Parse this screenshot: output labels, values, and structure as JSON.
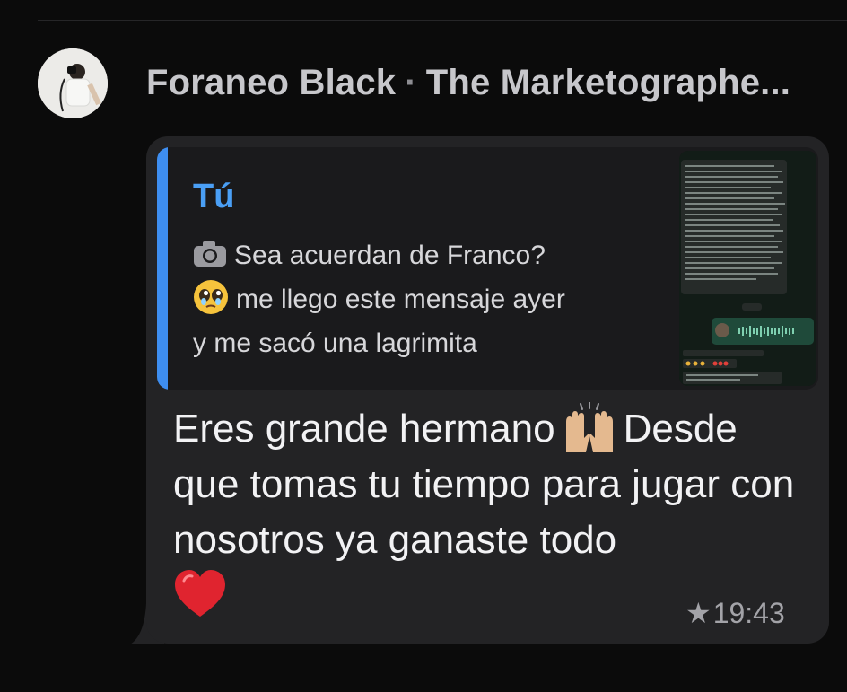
{
  "header": {
    "sender_name": "Foraneo Black",
    "separator": "·",
    "group_name": "The Marketographe..."
  },
  "message": {
    "reply": {
      "author": "Tú",
      "line1": "Sea acuerdan de Franco?",
      "line2": "me llego este mensaje ayer",
      "line3": "y me sacó una lagrimita",
      "attachment_icon": "camera-icon",
      "emoji": "pleading-face"
    },
    "body": {
      "part1": "Eres grande hermano",
      "part2": "Desde que tomas tu tiempo para jugar con nosotros ya ganaste todo",
      "hands_emoji": "raising-hands",
      "heart_emoji": "red-heart"
    },
    "status": {
      "star": "★",
      "time": "19:43"
    }
  },
  "colors": {
    "background": "#0b0b0b",
    "bubble": "#232325",
    "quote_bg": "#1a1a1c",
    "accent_blue": "#3e8ef0",
    "author_blue": "#4a9ff5"
  }
}
